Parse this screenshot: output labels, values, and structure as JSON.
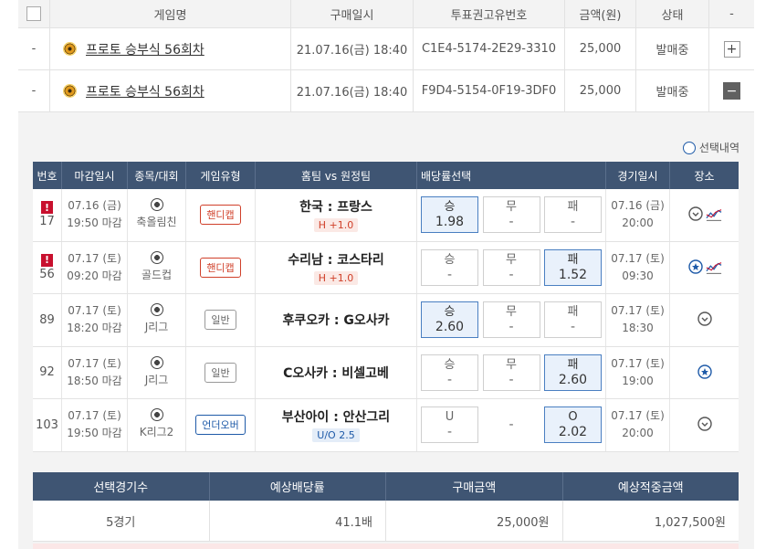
{
  "purchase": {
    "headers": {
      "name": "게임명",
      "date": "구매일시",
      "code": "투표권고유번호",
      "amount": "금액(원)",
      "status": "상태",
      "more": "-"
    },
    "rows": [
      {
        "dash": "-",
        "name": "프로토 승부식 56회차",
        "date": "21.07.16(금) 18:40",
        "code": "C1E4-5174-2E29-3310",
        "amount": "25,000",
        "status": "발매중",
        "toggle": "+"
      },
      {
        "dash": "-",
        "name": "프로토 승부식 56회차",
        "date": "21.07.16(금) 18:40",
        "code": "F9D4-5154-0F19-3DF0",
        "amount": "25,000",
        "status": "발매중",
        "toggle": "−"
      }
    ]
  },
  "details": {
    "selection_history": "선택내역",
    "headers": {
      "no": "번호",
      "close": "마감일시",
      "sport": "종목/대회",
      "type": "게임유형",
      "teams": "홈팀 vs 원정팀",
      "odds": "배당률선택",
      "gdate": "경기일시",
      "place": "장소"
    },
    "games": [
      {
        "no": "17",
        "alert": "!",
        "close_date": "07.16 (금)",
        "close_time": "19:50 마감",
        "league": "축올림친",
        "type": "핸디캡",
        "teams": "한국 : 프랑스",
        "handicap": "H +1.0",
        "o1_label": "승",
        "o1_val": "1.98",
        "o2_label": "무",
        "o2_val": "-",
        "o3_label": "패",
        "o3_val": "-",
        "game_date": "07.16 (금)",
        "game_time": "20:00"
      },
      {
        "no": "56",
        "alert": "!",
        "close_date": "07.17 (토)",
        "close_time": "09:20 마감",
        "league": "골드컵",
        "type": "핸디캡",
        "teams": "수리남 : 코스타리",
        "handicap": "H +1.0",
        "o1_label": "승",
        "o1_val": "-",
        "o2_label": "무",
        "o2_val": "-",
        "o3_label": "패",
        "o3_val": "1.52",
        "game_date": "07.17 (토)",
        "game_time": "09:30"
      },
      {
        "no": "89",
        "close_date": "07.17 (토)",
        "close_time": "18:20 마감",
        "league": "J리그",
        "type": "일반",
        "teams": "후쿠오카 : G오사카",
        "o1_label": "승",
        "o1_val": "2.60",
        "o2_label": "무",
        "o2_val": "-",
        "o3_label": "패",
        "o3_val": "-",
        "game_date": "07.17 (토)",
        "game_time": "18:30"
      },
      {
        "no": "92",
        "close_date": "07.17 (토)",
        "close_time": "18:50 마감",
        "league": "J리그",
        "type": "일반",
        "teams": "C오사카 : 비셀고베",
        "o1_label": "승",
        "o1_val": "-",
        "o2_label": "무",
        "o2_val": "-",
        "o3_label": "패",
        "o3_val": "2.60",
        "game_date": "07.17 (토)",
        "game_time": "19:00"
      },
      {
        "no": "103",
        "close_date": "07.17 (토)",
        "close_time": "19:50 마감",
        "league": "K리그2",
        "type": "언더오버",
        "teams": "부산아이 : 안산그리",
        "handicap": "U/O 2.5",
        "o1_label": "U",
        "o1_val": "-",
        "o2_label": "",
        "o2_val": "-",
        "o3_label": "O",
        "o3_val": "2.02",
        "game_date": "07.17 (토)",
        "game_time": "20:00"
      }
    ]
  },
  "summary": {
    "headers": {
      "count": "선택경기수",
      "odds": "예상배당률",
      "amount": "구매금액",
      "win": "예상적중금액"
    },
    "values": {
      "count": "5경기",
      "odds": "41.1배",
      "amount": "25,000원",
      "win": "1,027,500원"
    }
  },
  "colors": {
    "header_bg": "#3f5573",
    "selected_odds_bg": "#e9f1fb",
    "accent_red": "#c8102e",
    "accent_blue": "#1e5aa8"
  }
}
